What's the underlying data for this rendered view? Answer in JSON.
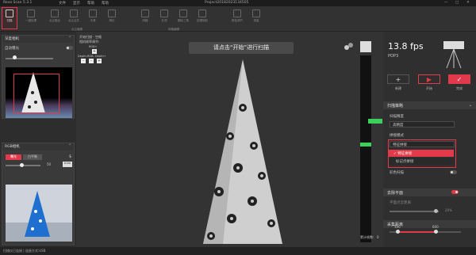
{
  "app": {
    "title": "Revo Scan 5.3.1",
    "project": "Project20182023134505",
    "menu": [
      "文件",
      "显示",
      "帮助",
      "帮助"
    ]
  },
  "toolbar": {
    "scan_label": "扫描",
    "tools": [
      "一键处理",
      "点云融合",
      "点云合并",
      "平滑",
      "简化",
      "网格",
      "补洞",
      "删除三角",
      "纹理映射",
      "颜色调节",
      "测量"
    ],
    "group_left": "点云编辑",
    "group_right": "网格编辑"
  },
  "left": {
    "depth_title": "深度相机",
    "auto_exposure": "自动曝光",
    "rgb_title": "RGB相机",
    "rgb_tabs": [
      "曝光",
      "白平衡"
    ],
    "exposure_value": "50",
    "auto_label": "Auto",
    "s_label": "$"
  },
  "viewport": {
    "info_lines": [
      "开始扫描 - 空格",
      "相机帧率调节:",
      "RGB+",
      "Depth-",
      "RGB-",
      "Depth+"
    ],
    "hint": "请点击“开始”进行扫描",
    "distance_label": "累计帧数:",
    "distance_value": "0"
  },
  "right": {
    "fps": "13.8 fps",
    "device": "POP3",
    "buttons": [
      {
        "icon": "+",
        "label": "新建"
      },
      {
        "icon": "▶",
        "label": "开始"
      },
      {
        "icon": "✓",
        "label": "完成"
      }
    ],
    "scan_section": "扫描策略",
    "precision_label": "扫描精度",
    "precision_value": "高精度",
    "mode_label": "拼接模式",
    "mode_value": "特征拼接",
    "mode_options": [
      {
        "label": "特征拼接",
        "checked": true
      },
      {
        "label": "标记点拼接",
        "checked": false
      }
    ],
    "color_fuse": "彩色扫描",
    "remove_plane": "去除平面",
    "plane_label": "平面点云距离",
    "plane_value": "20%",
    "distance_section": "采集距离",
    "dist_min": "100",
    "dist_max": "600"
  },
  "status": {
    "text": "扫描仪已连接 | 连接方式:USB"
  },
  "colors": {
    "accent": "#e23a4a",
    "point_green": "#3ccf5a"
  }
}
